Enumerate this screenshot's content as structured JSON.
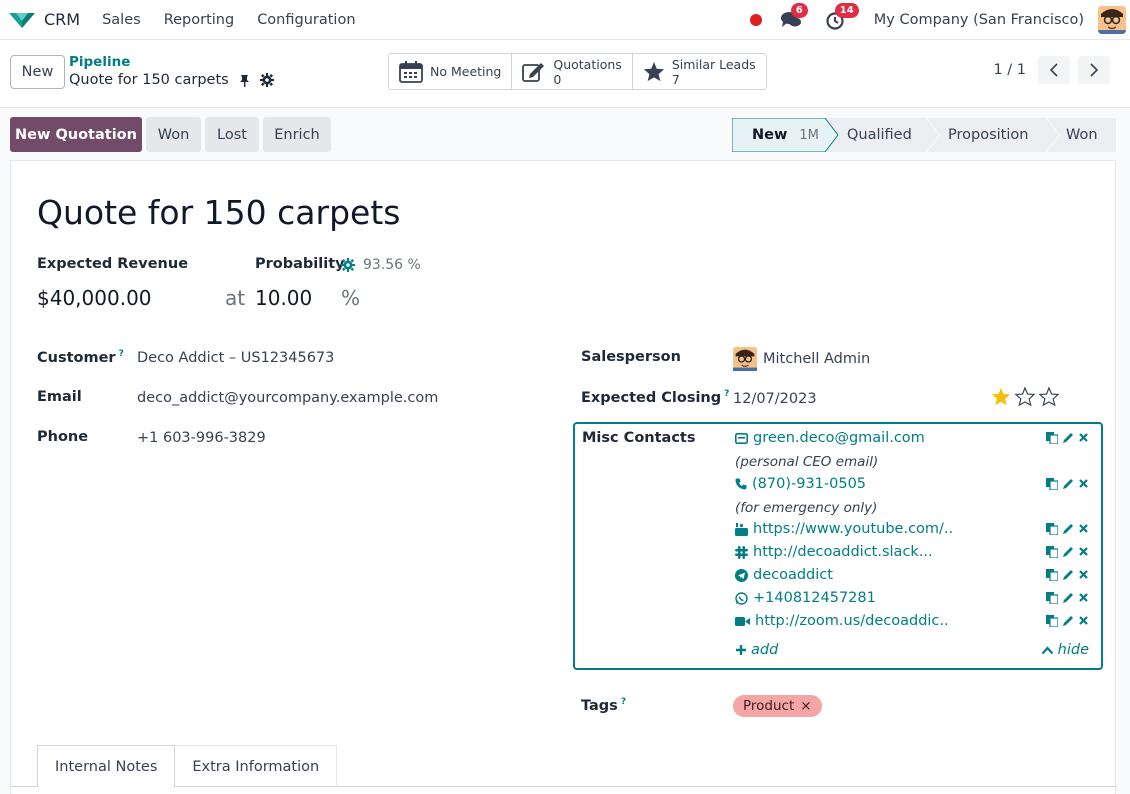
{
  "navbar": {
    "app_name": "CRM",
    "menu": [
      "Sales",
      "Reporting",
      "Configuration"
    ],
    "messages_count": "6",
    "activities_count": "14",
    "company": "My Company (San Francisco)"
  },
  "control_panel": {
    "new_label": "New",
    "breadcrumb_parent": "Pipeline",
    "breadcrumb_current": "Quote for 150 carpets",
    "smart_buttons": {
      "meeting_label": "No Meeting",
      "quotations_label": "Quotations",
      "quotations_count": "0",
      "similar_label": "Similar Leads",
      "similar_count": "7"
    },
    "pager": "1 / 1"
  },
  "statusbar": {
    "buttons": {
      "new_quotation": "New Quotation",
      "won": "Won",
      "lost": "Lost",
      "enrich": "Enrich"
    },
    "stages": [
      {
        "label": "New",
        "extra": "1M",
        "active": true
      },
      {
        "label": "Qualified",
        "active": false
      },
      {
        "label": "Proposition",
        "active": false
      },
      {
        "label": "Won",
        "active": false
      }
    ]
  },
  "form": {
    "title": "Quote for 150 carpets",
    "expected_revenue_label": "Expected Revenue",
    "expected_revenue": "$40,000.00",
    "at_label": "at",
    "probability_label": "Probability",
    "probability_auto": "93.56 %",
    "probability_value": "10.00",
    "percent_sign": "%",
    "customer_label": "Customer",
    "customer_value": "Deco Addict – US12345673",
    "email_label": "Email",
    "email_value": "deco_addict@yourcompany.example.com",
    "phone_label": "Phone",
    "phone_value": "+1 603-996-3829",
    "salesperson_label": "Salesperson",
    "salesperson_value": "Mitchell Admin",
    "expected_closing_label": "Expected Closing",
    "expected_closing_value": "12/07/2023",
    "priority_stars": 1,
    "misc_contacts_label": "Misc Contacts",
    "misc_contacts": {
      "email": "green.deco@gmail.com",
      "email_note": "(personal CEO email)",
      "phone": "(870)-931-0505",
      "phone_note": "(for emergency only)",
      "youtube": "https://www.youtube.com/..",
      "slack": "http://decoaddict.slack...",
      "telegram": "decoaddict",
      "whatsapp": "+140812457281",
      "zoom": "http://zoom.us/decoaddic..",
      "add_label": "add",
      "hide_label": "hide"
    },
    "tags_label": "Tags",
    "tag_value": "Product",
    "tag_remove": "×",
    "help_mark": "?"
  },
  "tabs": [
    "Internal Notes",
    "Extra Information"
  ],
  "colors": {
    "primary": "#714b67",
    "accent": "#017e84",
    "badge": "#e02c45",
    "tag": "#f4a5a5",
    "star": "#f3c00b"
  }
}
